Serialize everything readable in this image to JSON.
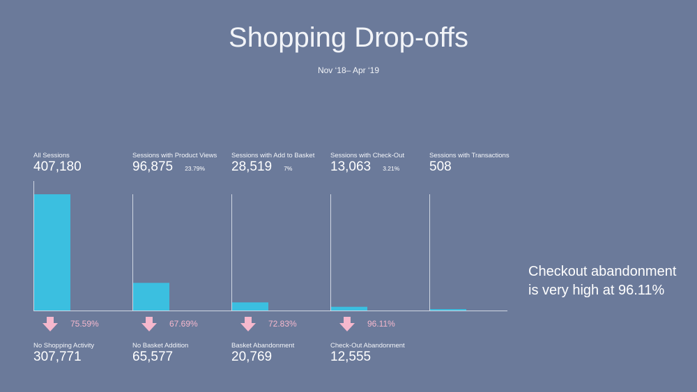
{
  "header": {
    "title": "Shopping Drop-offs",
    "subtitle": "Nov ‘18– Apr ‘19"
  },
  "callout": {
    "text": "Checkout abandonment is very high at 96.11%"
  },
  "colors": {
    "background": "#6b7a9a",
    "bar": "#3bbfe0",
    "arrow": "#f6b8cd",
    "axis": "#d0d6e2"
  },
  "chart_data": {
    "type": "bar",
    "title": "Shopping Drop-offs",
    "subtitle": "Nov ‘18– Apr ‘19",
    "categories": [
      "All Sessions",
      "Sessions with Product Views",
      "Sessions with Add to Basket",
      "Sessions with Check-Out",
      "Sessions with Transactions"
    ],
    "values": [
      407180,
      96875,
      28519,
      13063,
      508
    ],
    "value_labels": [
      "407,180",
      "96,875",
      "28,519",
      "13,063",
      "508"
    ],
    "share_labels": [
      "",
      "23.79%",
      "7%",
      "3.21%",
      ""
    ],
    "drop_offs": [
      {
        "label": "No Shopping Activity",
        "value": 307771,
        "value_label": "307,771",
        "percent": "75.59%"
      },
      {
        "label": "No Basket Addition",
        "value": 65577,
        "value_label": "65,577",
        "percent": "67.69%"
      },
      {
        "label": "Basket Abandonment",
        "value": 20769,
        "value_label": "20,769",
        "percent": "72.83%"
      },
      {
        "label": "Check-Out Abandonment",
        "value": 12555,
        "value_label": "12,555",
        "percent": "96.11%"
      }
    ],
    "ylim": [
      0,
      407180
    ],
    "grid": false,
    "legend": "none"
  }
}
